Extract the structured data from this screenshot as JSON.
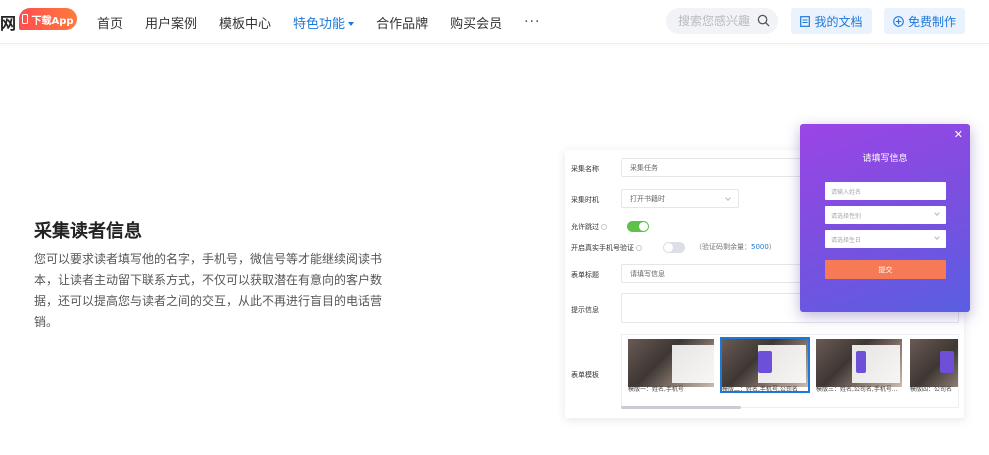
{
  "header": {
    "logo_text": "网",
    "app_badge": "下载App",
    "nav": [
      {
        "label": "首页",
        "active": false
      },
      {
        "label": "用户案例",
        "active": false
      },
      {
        "label": "模板中心",
        "active": false
      },
      {
        "label": "特色功能",
        "active": true
      },
      {
        "label": "合作品牌",
        "active": false
      },
      {
        "label": "购买会员",
        "active": false
      }
    ],
    "more": "···",
    "search_placeholder": "搜索您感兴趣",
    "my_docs": "我的文档",
    "free_make": "免费制作"
  },
  "feature": {
    "title": "采集读者信息",
    "description": "您可以要求读者填写他的名字，手机号，微信号等才能继续阅读书本，让读者主动留下联系方式，不仅可以获取潜在有意向的客户数据，还可以提高您与读者之间的交互，从此不再进行盲目的电话营销。"
  },
  "form": {
    "labels": {
      "name": "采集名称",
      "timing": "采集时机",
      "allow_skip": "允许跳过",
      "verify": "开启真实手机号验证",
      "form_title": "表单标题",
      "hint": "提示信息",
      "template": "表单模板"
    },
    "values": {
      "name": "采集任务",
      "timing": "打开书籍时",
      "verify_note": "（验证码剩余量：",
      "verify_count": "5000",
      "verify_note_end": "）",
      "form_title": "请填写信息"
    },
    "templates": [
      "模版一：姓名,手机号",
      "模版二：姓名,手机号,公司名",
      "模版三：姓名,公司名,手机号...",
      "模版四：公司名"
    ]
  },
  "popup": {
    "close": "✕",
    "title": "请填写信息",
    "name_placeholder": "请输入姓名",
    "gender_placeholder": "请选择性别",
    "birthday_placeholder": "请选择生日",
    "submit": "提交"
  },
  "colors": {
    "accent": "#1e78d8",
    "toggle_on": "#5fc14a",
    "popup_top": "#9b45e6",
    "popup_bottom": "#5a5fe2",
    "submit": "#f67a55"
  }
}
